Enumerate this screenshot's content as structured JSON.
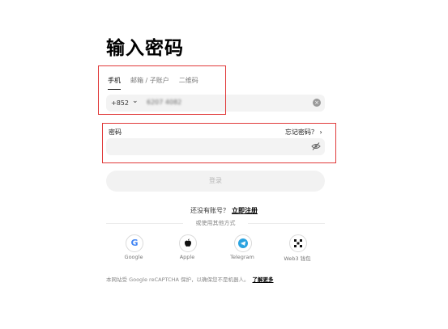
{
  "header": {
    "title": "输入密码"
  },
  "tabs": [
    {
      "label": "手机",
      "active": true
    },
    {
      "label": "邮箱 / 子账户",
      "active": false
    },
    {
      "label": "二维码",
      "active": false
    }
  ],
  "phone": {
    "country_code": "+852",
    "value": "6207 4082"
  },
  "password": {
    "label": "密码",
    "forgot_label": "忘记密码？",
    "value": ""
  },
  "login_button": {
    "label": "登录"
  },
  "signup": {
    "prompt": "还没有账号？",
    "link": "立即注册"
  },
  "divider": {
    "label": "或使用其他方式"
  },
  "social": [
    {
      "label": "Google",
      "icon": "google-icon"
    },
    {
      "label": "Apple",
      "icon": "apple-icon"
    },
    {
      "label": "Telegram",
      "icon": "telegram-icon"
    },
    {
      "label": "Web3 钱包",
      "icon": "web3-wallet-icon"
    }
  ],
  "footer": {
    "text": "本网站受 Google reCAPTCHA 保护，以确保您不是机器人。",
    "link": "了解更多"
  },
  "colors": {
    "highlight": "#e03a3a",
    "google_blue": "#4285f4",
    "telegram_blue": "#2aa3e0"
  }
}
